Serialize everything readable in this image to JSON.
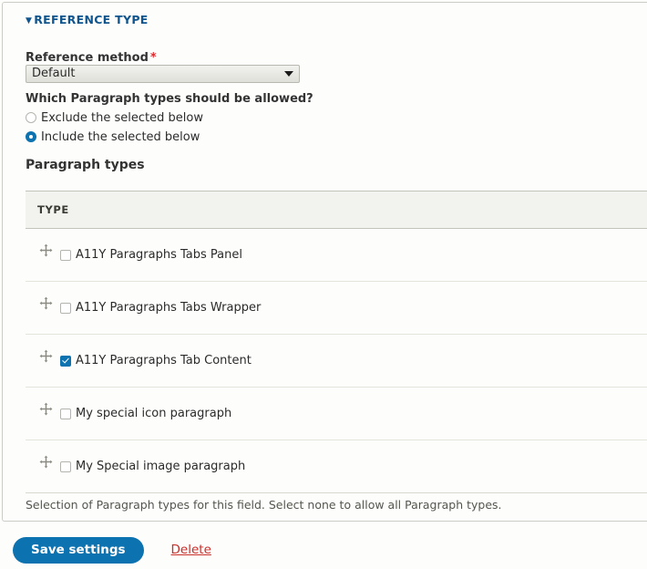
{
  "fieldset": {
    "legend": "REFERENCE TYPE",
    "legend_toggle_icon": "triangle-down-icon"
  },
  "reference_method": {
    "label": "Reference method",
    "required_marker": "*",
    "selected_value": "Default",
    "dropdown_icon": "chevron-down-icon"
  },
  "allowed_question": {
    "label": "Which Paragraph types should be allowed?",
    "options": [
      {
        "label": "Exclude the selected below",
        "selected": false
      },
      {
        "label": "Include the selected below",
        "selected": true
      }
    ]
  },
  "paragraph_types": {
    "heading": "Paragraph types",
    "column_header": "TYPE",
    "drag_icon": "move-cross-icon",
    "rows": [
      {
        "label": "A11Y Paragraphs Tabs Panel",
        "checked": false
      },
      {
        "label": "A11Y Paragraphs Tabs Wrapper",
        "checked": false
      },
      {
        "label": "A11Y Paragraphs Tab Content",
        "checked": true
      },
      {
        "label": "My special icon paragraph",
        "checked": false
      },
      {
        "label": "My Special image paragraph",
        "checked": false
      }
    ],
    "description": "Selection of Paragraph types for this field. Select none to allow all Paragraph types."
  },
  "actions": {
    "save_label": "Save settings",
    "delete_label": "Delete"
  },
  "colors": {
    "accent_blue": "#0c72b0",
    "legend_blue": "#10558d",
    "required_red": "#e3292c",
    "delete_red": "#c9302c",
    "header_row_bg": "#f2f3ee"
  }
}
